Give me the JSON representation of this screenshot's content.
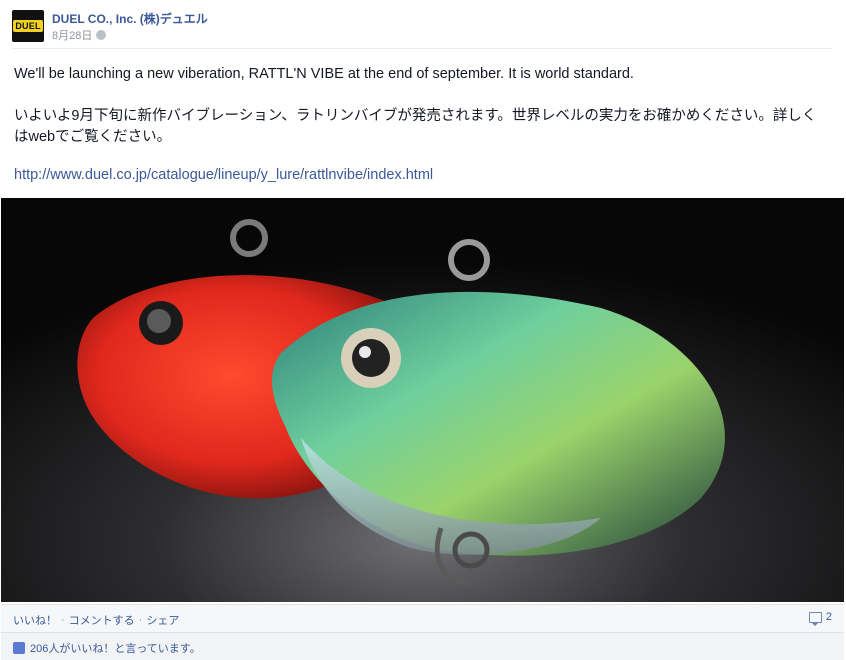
{
  "post": {
    "page_name": "DUEL CO., Inc. (株)デュエル",
    "avatar_text": "DUEL",
    "date": "8月28日",
    "text_en": "We'll be launching a new viberation, RATTL'N VIBE at the end of september. It is world standard.",
    "text_ja": "いよいよ9月下旬に新作バイブレーション、ラトリンバイブが発売されます。世界レベルの実力をお確かめください。詳しくはwebでご覧ください。",
    "link": "http://www.duel.co.jp/catalogue/lineup/y_lure/rattlnvibe/index.html"
  },
  "actions": {
    "like": "いいね！",
    "comment": "コメントする",
    "share": "シェア",
    "separator": "·",
    "comment_count": "2"
  },
  "likes": {
    "summary": "206人がいいね！と言っています。"
  },
  "colors": {
    "link": "#3b5998",
    "action_bg": "#f6f7f9",
    "likes_bg": "#f2f3f5"
  }
}
